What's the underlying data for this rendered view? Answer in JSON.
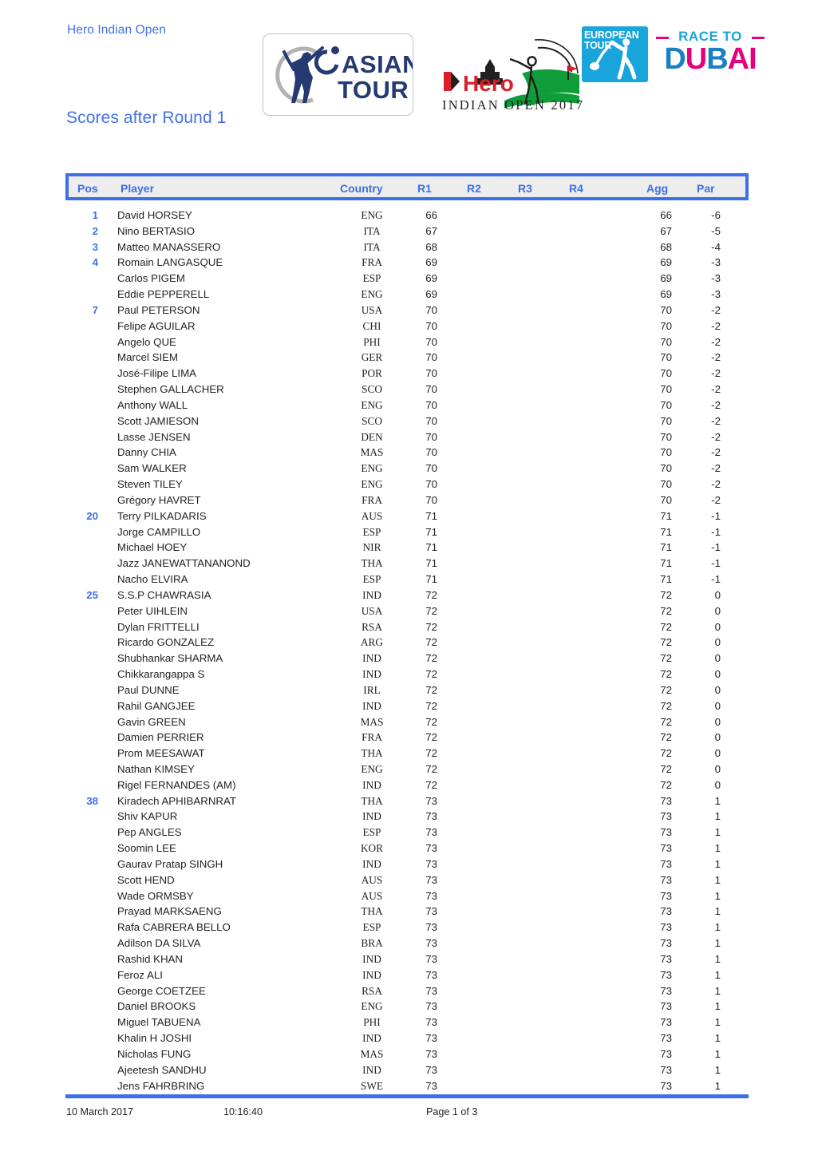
{
  "header": {
    "event_name": "Hero Indian Open",
    "page_title": "Scores after Round 1",
    "logos": {
      "asian_tour": {
        "name": "asian-tour-logo",
        "line1": "ASIAN",
        "line2": "TOUR"
      },
      "hero_indian_open": {
        "name": "hero-indian-open-2017-logo",
        "brand": "Hero",
        "subtitle": "INDIAN OPEN 2017"
      },
      "european_tour": {
        "name": "european-tour-logo",
        "line1": "EUROPEAN",
        "line2": "TOUR"
      },
      "race_to_dubai": {
        "name": "race-to-dubai-logo",
        "top": "RACE TO",
        "bottom_a": "D",
        "bottom_b": "U",
        "bottom_c": "B",
        "bottom_d": "A",
        "bottom_e": "I"
      }
    }
  },
  "table": {
    "columns": [
      {
        "key": "pos",
        "label": "Pos"
      },
      {
        "key": "player",
        "label": "Player"
      },
      {
        "key": "country",
        "label": "Country"
      },
      {
        "key": "r1",
        "label": "R1"
      },
      {
        "key": "r2",
        "label": "R2"
      },
      {
        "key": "r3",
        "label": "R3"
      },
      {
        "key": "r4",
        "label": "R4"
      },
      {
        "key": "agg",
        "label": "Agg"
      },
      {
        "key": "par",
        "label": "Par"
      }
    ],
    "rows": [
      {
        "pos": "1",
        "player": "David HORSEY",
        "country": "ENG",
        "r1": "66",
        "r2": "",
        "r3": "",
        "r4": "",
        "agg": "66",
        "par": "-6"
      },
      {
        "pos": "2",
        "player": "Nino BERTASIO",
        "country": "ITA",
        "r1": "67",
        "r2": "",
        "r3": "",
        "r4": "",
        "agg": "67",
        "par": "-5"
      },
      {
        "pos": "3",
        "player": "Matteo MANASSERO",
        "country": "ITA",
        "r1": "68",
        "r2": "",
        "r3": "",
        "r4": "",
        "agg": "68",
        "par": "-4"
      },
      {
        "pos": "4",
        "player": "Romain LANGASQUE",
        "country": "FRA",
        "r1": "69",
        "r2": "",
        "r3": "",
        "r4": "",
        "agg": "69",
        "par": "-3"
      },
      {
        "pos": "",
        "player": "Carlos PIGEM",
        "country": "ESP",
        "r1": "69",
        "r2": "",
        "r3": "",
        "r4": "",
        "agg": "69",
        "par": "-3"
      },
      {
        "pos": "",
        "player": "Eddie PEPPERELL",
        "country": "ENG",
        "r1": "69",
        "r2": "",
        "r3": "",
        "r4": "",
        "agg": "69",
        "par": "-3"
      },
      {
        "pos": "7",
        "player": "Paul PETERSON",
        "country": "USA",
        "r1": "70",
        "r2": "",
        "r3": "",
        "r4": "",
        "agg": "70",
        "par": "-2"
      },
      {
        "pos": "",
        "player": "Felipe AGUILAR",
        "country": "CHI",
        "r1": "70",
        "r2": "",
        "r3": "",
        "r4": "",
        "agg": "70",
        "par": "-2"
      },
      {
        "pos": "",
        "player": "Angelo QUE",
        "country": "PHI",
        "r1": "70",
        "r2": "",
        "r3": "",
        "r4": "",
        "agg": "70",
        "par": "-2"
      },
      {
        "pos": "",
        "player": "Marcel SIEM",
        "country": "GER",
        "r1": "70",
        "r2": "",
        "r3": "",
        "r4": "",
        "agg": "70",
        "par": "-2"
      },
      {
        "pos": "",
        "player": "José-Filipe LIMA",
        "country": "POR",
        "r1": "70",
        "r2": "",
        "r3": "",
        "r4": "",
        "agg": "70",
        "par": "-2"
      },
      {
        "pos": "",
        "player": "Stephen GALLACHER",
        "country": "SCO",
        "r1": "70",
        "r2": "",
        "r3": "",
        "r4": "",
        "agg": "70",
        "par": "-2"
      },
      {
        "pos": "",
        "player": "Anthony WALL",
        "country": "ENG",
        "r1": "70",
        "r2": "",
        "r3": "",
        "r4": "",
        "agg": "70",
        "par": "-2"
      },
      {
        "pos": "",
        "player": "Scott JAMIESON",
        "country": "SCO",
        "r1": "70",
        "r2": "",
        "r3": "",
        "r4": "",
        "agg": "70",
        "par": "-2"
      },
      {
        "pos": "",
        "player": "Lasse JENSEN",
        "country": "DEN",
        "r1": "70",
        "r2": "",
        "r3": "",
        "r4": "",
        "agg": "70",
        "par": "-2"
      },
      {
        "pos": "",
        "player": "Danny CHIA",
        "country": "MAS",
        "r1": "70",
        "r2": "",
        "r3": "",
        "r4": "",
        "agg": "70",
        "par": "-2"
      },
      {
        "pos": "",
        "player": "Sam WALKER",
        "country": "ENG",
        "r1": "70",
        "r2": "",
        "r3": "",
        "r4": "",
        "agg": "70",
        "par": "-2"
      },
      {
        "pos": "",
        "player": "Steven TILEY",
        "country": "ENG",
        "r1": "70",
        "r2": "",
        "r3": "",
        "r4": "",
        "agg": "70",
        "par": "-2"
      },
      {
        "pos": "",
        "player": "Grégory HAVRET",
        "country": "FRA",
        "r1": "70",
        "r2": "",
        "r3": "",
        "r4": "",
        "agg": "70",
        "par": "-2"
      },
      {
        "pos": "20",
        "player": "Terry PILKADARIS",
        "country": "AUS",
        "r1": "71",
        "r2": "",
        "r3": "",
        "r4": "",
        "agg": "71",
        "par": "-1"
      },
      {
        "pos": "",
        "player": "Jorge CAMPILLO",
        "country": "ESP",
        "r1": "71",
        "r2": "",
        "r3": "",
        "r4": "",
        "agg": "71",
        "par": "-1"
      },
      {
        "pos": "",
        "player": "Michael HOEY",
        "country": "NIR",
        "r1": "71",
        "r2": "",
        "r3": "",
        "r4": "",
        "agg": "71",
        "par": "-1"
      },
      {
        "pos": "",
        "player": "Jazz JANEWATTANANOND",
        "country": "THA",
        "r1": "71",
        "r2": "",
        "r3": "",
        "r4": "",
        "agg": "71",
        "par": "-1"
      },
      {
        "pos": "",
        "player": "Nacho ELVIRA",
        "country": "ESP",
        "r1": "71",
        "r2": "",
        "r3": "",
        "r4": "",
        "agg": "71",
        "par": "-1"
      },
      {
        "pos": "25",
        "player": "S.S.P CHAWRASIA",
        "country": "IND",
        "r1": "72",
        "r2": "",
        "r3": "",
        "r4": "",
        "agg": "72",
        "par": "0"
      },
      {
        "pos": "",
        "player": "Peter UIHLEIN",
        "country": "USA",
        "r1": "72",
        "r2": "",
        "r3": "",
        "r4": "",
        "agg": "72",
        "par": "0"
      },
      {
        "pos": "",
        "player": "Dylan FRITTELLI",
        "country": "RSA",
        "r1": "72",
        "r2": "",
        "r3": "",
        "r4": "",
        "agg": "72",
        "par": "0"
      },
      {
        "pos": "",
        "player": "Ricardo GONZALEZ",
        "country": "ARG",
        "r1": "72",
        "r2": "",
        "r3": "",
        "r4": "",
        "agg": "72",
        "par": "0"
      },
      {
        "pos": "",
        "player": "Shubhankar SHARMA",
        "country": "IND",
        "r1": "72",
        "r2": "",
        "r3": "",
        "r4": "",
        "agg": "72",
        "par": "0"
      },
      {
        "pos": "",
        "player": "Chikkarangappa S",
        "country": "IND",
        "r1": "72",
        "r2": "",
        "r3": "",
        "r4": "",
        "agg": "72",
        "par": "0"
      },
      {
        "pos": "",
        "player": "Paul DUNNE",
        "country": "IRL",
        "r1": "72",
        "r2": "",
        "r3": "",
        "r4": "",
        "agg": "72",
        "par": "0"
      },
      {
        "pos": "",
        "player": "Rahil GANGJEE",
        "country": "IND",
        "r1": "72",
        "r2": "",
        "r3": "",
        "r4": "",
        "agg": "72",
        "par": "0"
      },
      {
        "pos": "",
        "player": "Gavin GREEN",
        "country": "MAS",
        "r1": "72",
        "r2": "",
        "r3": "",
        "r4": "",
        "agg": "72",
        "par": "0"
      },
      {
        "pos": "",
        "player": "Damien PERRIER",
        "country": "FRA",
        "r1": "72",
        "r2": "",
        "r3": "",
        "r4": "",
        "agg": "72",
        "par": "0"
      },
      {
        "pos": "",
        "player": "Prom MEESAWAT",
        "country": "THA",
        "r1": "72",
        "r2": "",
        "r3": "",
        "r4": "",
        "agg": "72",
        "par": "0"
      },
      {
        "pos": "",
        "player": "Nathan KIMSEY",
        "country": "ENG",
        "r1": "72",
        "r2": "",
        "r3": "",
        "r4": "",
        "agg": "72",
        "par": "0"
      },
      {
        "pos": "",
        "player": "Rigel FERNANDES (AM)",
        "country": "IND",
        "r1": "72",
        "r2": "",
        "r3": "",
        "r4": "",
        "agg": "72",
        "par": "0"
      },
      {
        "pos": "38",
        "player": "Kiradech APHIBARNRAT",
        "country": "THA",
        "r1": "73",
        "r2": "",
        "r3": "",
        "r4": "",
        "agg": "73",
        "par": "1"
      },
      {
        "pos": "",
        "player": "Shiv KAPUR",
        "country": "IND",
        "r1": "73",
        "r2": "",
        "r3": "",
        "r4": "",
        "agg": "73",
        "par": "1"
      },
      {
        "pos": "",
        "player": "Pep ANGLES",
        "country": "ESP",
        "r1": "73",
        "r2": "",
        "r3": "",
        "r4": "",
        "agg": "73",
        "par": "1"
      },
      {
        "pos": "",
        "player": "Soomin LEE",
        "country": "KOR",
        "r1": "73",
        "r2": "",
        "r3": "",
        "r4": "",
        "agg": "73",
        "par": "1"
      },
      {
        "pos": "",
        "player": "Gaurav Pratap SINGH",
        "country": "IND",
        "r1": "73",
        "r2": "",
        "r3": "",
        "r4": "",
        "agg": "73",
        "par": "1"
      },
      {
        "pos": "",
        "player": "Scott HEND",
        "country": "AUS",
        "r1": "73",
        "r2": "",
        "r3": "",
        "r4": "",
        "agg": "73",
        "par": "1"
      },
      {
        "pos": "",
        "player": "Wade ORMSBY",
        "country": "AUS",
        "r1": "73",
        "r2": "",
        "r3": "",
        "r4": "",
        "agg": "73",
        "par": "1"
      },
      {
        "pos": "",
        "player": "Prayad MARKSAENG",
        "country": "THA",
        "r1": "73",
        "r2": "",
        "r3": "",
        "r4": "",
        "agg": "73",
        "par": "1"
      },
      {
        "pos": "",
        "player": "Rafa CABRERA BELLO",
        "country": "ESP",
        "r1": "73",
        "r2": "",
        "r3": "",
        "r4": "",
        "agg": "73",
        "par": "1"
      },
      {
        "pos": "",
        "player": "Adilson DA SILVA",
        "country": "BRA",
        "r1": "73",
        "r2": "",
        "r3": "",
        "r4": "",
        "agg": "73",
        "par": "1"
      },
      {
        "pos": "",
        "player": "Rashid KHAN",
        "country": "IND",
        "r1": "73",
        "r2": "",
        "r3": "",
        "r4": "",
        "agg": "73",
        "par": "1"
      },
      {
        "pos": "",
        "player": "Feroz ALI",
        "country": "IND",
        "r1": "73",
        "r2": "",
        "r3": "",
        "r4": "",
        "agg": "73",
        "par": "1"
      },
      {
        "pos": "",
        "player": "George COETZEE",
        "country": "RSA",
        "r1": "73",
        "r2": "",
        "r3": "",
        "r4": "",
        "agg": "73",
        "par": "1"
      },
      {
        "pos": "",
        "player": "Daniel BROOKS",
        "country": "ENG",
        "r1": "73",
        "r2": "",
        "r3": "",
        "r4": "",
        "agg": "73",
        "par": "1"
      },
      {
        "pos": "",
        "player": "Miguel TABUENA",
        "country": "PHI",
        "r1": "73",
        "r2": "",
        "r3": "",
        "r4": "",
        "agg": "73",
        "par": "1"
      },
      {
        "pos": "",
        "player": "Khalin H JOSHI",
        "country": "IND",
        "r1": "73",
        "r2": "",
        "r3": "",
        "r4": "",
        "agg": "73",
        "par": "1"
      },
      {
        "pos": "",
        "player": "Nicholas FUNG",
        "country": "MAS",
        "r1": "73",
        "r2": "",
        "r3": "",
        "r4": "",
        "agg": "73",
        "par": "1"
      },
      {
        "pos": "",
        "player": "Ajeetesh SANDHU",
        "country": "IND",
        "r1": "73",
        "r2": "",
        "r3": "",
        "r4": "",
        "agg": "73",
        "par": "1"
      },
      {
        "pos": "",
        "player": "Jens FAHRBRING",
        "country": "SWE",
        "r1": "73",
        "r2": "",
        "r3": "",
        "r4": "",
        "agg": "73",
        "par": "1"
      }
    ]
  },
  "footer": {
    "date": "10 March 2017",
    "time": "10:16:40",
    "page": "Page 1 of 3"
  },
  "colors": {
    "accent_blue": "#3f6fe8",
    "title_blue": "#4271e8",
    "header_fill": "#ededed",
    "text": "#231f20",
    "et_blue": "#19A4DC",
    "rtd_pink": "#E5007E"
  }
}
